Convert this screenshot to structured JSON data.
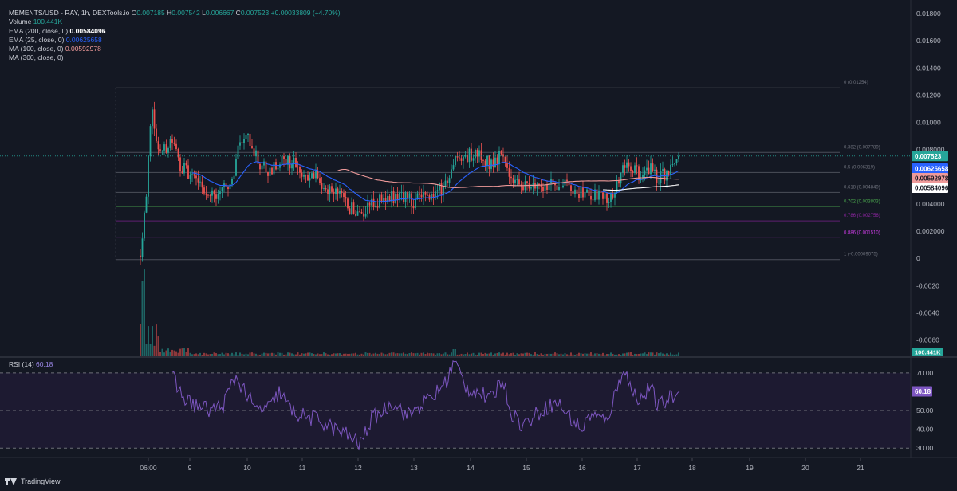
{
  "symbol_line": {
    "symbol": "MEMENTS/USD - RAY, 1h, DEXTools.io",
    "o_label": "O",
    "o_value": "0.007185",
    "h_label": "H",
    "h_value": "0.007542",
    "l_label": "L",
    "l_value": "0.006667",
    "c_label": "C",
    "c_value": "0.007523",
    "change": "+0.00033809 (+4.70%)"
  },
  "indicators": {
    "volume_label": "Volume",
    "volume_value": "100.441K",
    "ema200_label": "EMA (200, close, 0)",
    "ema200_value": "0.00584096",
    "ema25_label": "EMA (25, close, 0)",
    "ema25_value": "0.00625658",
    "ma100_label": "MA (100, close, 0)",
    "ma100_value": "0.00592978",
    "ma300_label": "MA (300, close, 0)"
  },
  "rsi": {
    "label": "RSI (14)",
    "value": "60.18",
    "current": 60.18,
    "upper": 70,
    "middle": 50,
    "lower": 30
  },
  "price_axis": {
    "ticks": [
      "0.01800",
      "0.01600",
      "0.01400",
      "0.01200",
      "0.01000",
      "0.008000",
      "0.006000",
      "0.004000",
      "0.002000",
      "0",
      "-0.0020",
      "-0.0040",
      "-0.0060"
    ],
    "min": -0.0072,
    "max": 0.019,
    "badges": {
      "last_price": "0.007523",
      "ema25": "0.00625658",
      "ma100": "0.00592978",
      "ema200": "0.00584096",
      "volume": "100.441K"
    }
  },
  "rsi_axis": {
    "ticks": [
      "70.00",
      "50.00",
      "40.00",
      "30.00"
    ],
    "current_badge": "60.18",
    "min": 25,
    "max": 78
  },
  "time_axis": {
    "labels": [
      "06:00",
      "9",
      "10",
      "11",
      "12",
      "13",
      "14",
      "15",
      "16",
      "17",
      "18",
      "19",
      "20",
      "21"
    ]
  },
  "fibonacci": [
    {
      "level": 0,
      "price": 0.01254,
      "label": "0 (0.01254)"
    },
    {
      "level": 0.382,
      "price": 0.007789,
      "label": "0.382 (0.007789)"
    },
    {
      "level": 0.5,
      "price": 0.006319,
      "label": "0.5 (0.006319)"
    },
    {
      "level": 0.618,
      "price": 0.004849,
      "label": "0.618 (0.004849)"
    },
    {
      "level": 0.702,
      "price": 0.003803,
      "label": "0.702 (0.003803)"
    },
    {
      "level": 0.786,
      "price": 0.002756,
      "label": "0.786 (0.002756)"
    },
    {
      "level": 0.886,
      "price": 0.00151,
      "label": "0.886 (0.001510)"
    },
    {
      "level": 1,
      "price": -9.075e-05,
      "label": "1 (-0.00009075)"
    }
  ],
  "colors": {
    "background": "#141823",
    "up": "#26a69a",
    "down": "#ef5350",
    "ema25": "#2962ff",
    "ma100": "#ef9a9a",
    "ema200": "#ffffff",
    "rsi_line": "#7e57c2",
    "rsi_band": "#1e1b33",
    "fib_gray": "#787b86",
    "fib_green": "#4caf50",
    "fib_purple": "#9c27b0",
    "fib_pink": "#e040fb"
  },
  "brand": {
    "name": "TradingView"
  }
}
